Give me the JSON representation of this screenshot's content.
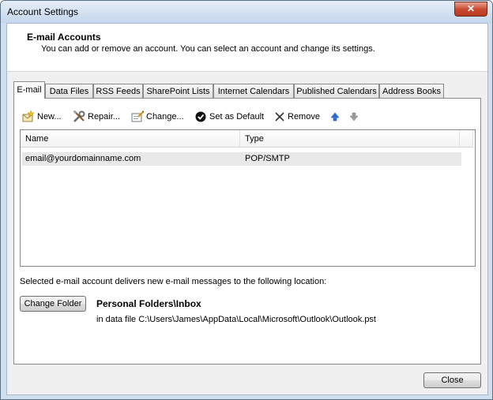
{
  "window": {
    "title": "Account Settings",
    "close_glyph": "✕"
  },
  "header": {
    "title": "E-mail Accounts",
    "description": "You can add or remove an account. You can select an account and change its settings."
  },
  "tabs": [
    {
      "label": "E-mail",
      "active": true
    },
    {
      "label": "Data Files"
    },
    {
      "label": "RSS Feeds"
    },
    {
      "label": "SharePoint Lists"
    },
    {
      "label": "Internet Calendars"
    },
    {
      "label": "Published Calendars"
    },
    {
      "label": "Address Books"
    }
  ],
  "toolbar": {
    "new_label": "New...",
    "repair_label": "Repair...",
    "change_label": "Change...",
    "default_label": "Set as Default",
    "remove_label": "Remove"
  },
  "accounts": {
    "columns": [
      "Name",
      "Type"
    ],
    "rows": [
      {
        "name": "email@yourdomainname.com",
        "type": "POP/SMTP"
      }
    ]
  },
  "delivery": {
    "info": "Selected e-mail account delivers new e-mail messages to the following location:",
    "change_folder_label": "Change Folder",
    "folder": "Personal Folders\\Inbox",
    "data_file": "in data file C:\\Users\\James\\AppData\\Local\\Microsoft\\Outlook\\Outlook.pst"
  },
  "footer": {
    "close_label": "Close"
  },
  "colors": {
    "accent_arrow": "#2f6fd0",
    "disabled_arrow": "#9a9a9a"
  }
}
